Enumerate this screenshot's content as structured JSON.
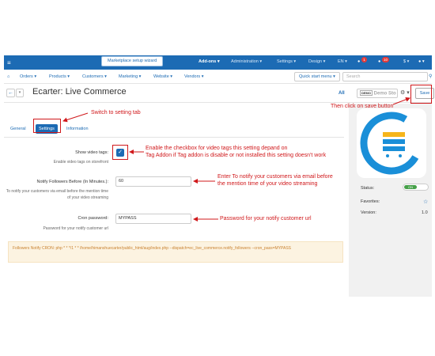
{
  "topbar": {
    "wizard": "Marketplace setup wizard",
    "items": [
      "Add-ons",
      "Administration",
      "Settings",
      "Design",
      "EN",
      "$"
    ],
    "badges": [
      "1",
      "10"
    ]
  },
  "nav": {
    "items": [
      "Orders",
      "Products",
      "Customers",
      "Marketing",
      "Website",
      "Vendors"
    ],
    "quick_start": "Quick start menu",
    "search_placeholder": "Search"
  },
  "header": {
    "title": "Ecarter: Live Commerce",
    "all": "All",
    "store_label": "Demo Sto",
    "store_badge": "DEMO",
    "save": "Save"
  },
  "tabs": [
    "General",
    "Settings",
    "Information"
  ],
  "form": {
    "video_tags_label": "Show video tags:",
    "video_tags_desc": "Enable video tags on storefront",
    "notify_label": "Notify Followers Before (In Minutes.):",
    "notify_desc": "To notify your customers via email before the mention time of your video streaming",
    "notify_value": "60",
    "cron_label": "Cron password:",
    "cron_desc": "Password for your notify customer url",
    "cron_value": "MYPASS"
  },
  "note": "Followers Notify CRON: php * * */1 * * /home/himanshuecarter/public_html/aug/index.php --dispatch=ec_live_commerce.notify_followers --cron_pass=MYPASS",
  "sidebar": {
    "status_label": "Status:",
    "status_value": "ON",
    "favorites_label": "Favorites:",
    "version_label": "Version:",
    "version_value": "1.0"
  },
  "annotations": {
    "switch_tab": "Switch to setting tab",
    "save": "Then click on save button",
    "checkbox_line1": "Enable the checkbox for video tags this setting depand on",
    "checkbox_line2": "Tag Addon if Tag addon is disable or not installed this setting doesn't work",
    "notify_line1": "Enter To notify your customers via email before",
    "notify_line2": "the mention time of your video streaming",
    "password": "Password for your notify customer url"
  },
  "colors": {
    "primary": "#1c6bb4",
    "annotation": "#d0181b",
    "note_bg": "#fcf3e1",
    "note_text": "#c98230"
  }
}
